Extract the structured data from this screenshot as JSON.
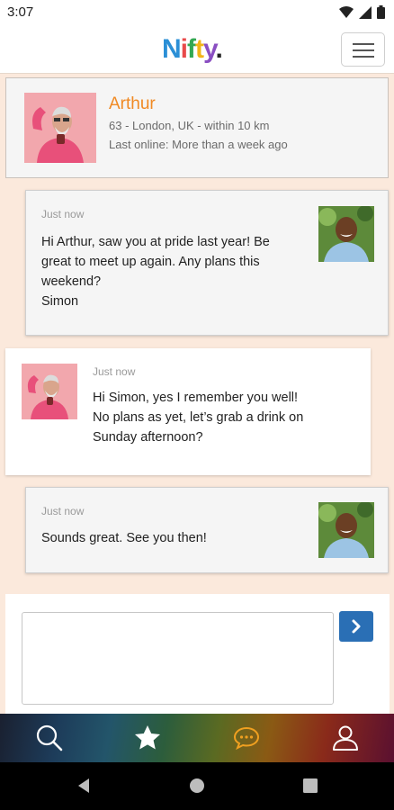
{
  "status": {
    "time": "3:07"
  },
  "app": {
    "logo": "Nifty."
  },
  "profile": {
    "name": "Arthur",
    "info": "63 - London, UK - within 10 km",
    "last_online": "Last online: More than a week ago"
  },
  "messages": [
    {
      "time": "Just now",
      "lines": [
        "Hi Arthur, saw you at pride last year! Be",
        "great to meet up again. Any plans this",
        "weekend?",
        "Simon"
      ]
    },
    {
      "time": "Just now",
      "lines": [
        "Hi Simon, yes I remember you well!",
        "No plans as yet, let’s grab a drink on",
        "Sunday afternoon?"
      ]
    },
    {
      "time": "Just now",
      "lines": [
        "Sounds great. See you then!"
      ]
    }
  ],
  "compose": {
    "value": ""
  },
  "tabs": [
    {
      "icon": "search-icon"
    },
    {
      "icon": "star-icon"
    },
    {
      "icon": "chat-icon",
      "active": true
    },
    {
      "icon": "profile-icon"
    }
  ],
  "colors": {
    "accent": "#f08a24",
    "send": "#2a6fb5",
    "background": "#fbe9dc"
  }
}
